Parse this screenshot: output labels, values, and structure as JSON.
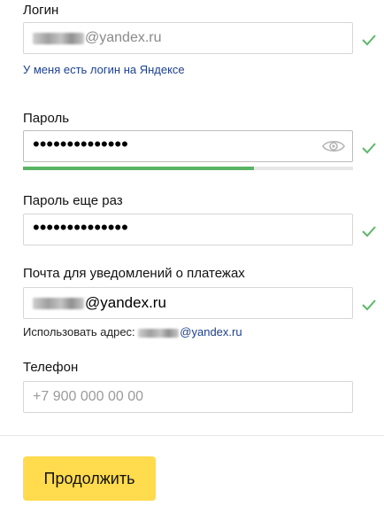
{
  "login": {
    "label": "Логин",
    "value_suffix": "@yandex.ru",
    "link": "У меня есть логин на Яндексе"
  },
  "password": {
    "label": "Пароль",
    "masked": "••••••••••••••",
    "strength": 0.7
  },
  "password_repeat": {
    "label": "Пароль еще раз",
    "masked": "••••••••••••••"
  },
  "notify_email": {
    "label": "Почта для уведомлений о платежах",
    "value_suffix": "@yandex.ru",
    "hint_prefix": "Использовать адрес:",
    "hint_suffix": "@yandex.ru"
  },
  "phone": {
    "label": "Телефон",
    "placeholder": "+7 900 000 00 00"
  },
  "continue_button": "Продолжить",
  "colors": {
    "check": "#5cb868",
    "strength": "#59b463",
    "button": "#ffdb4d",
    "link": "#1c3f8f"
  },
  "icons": [
    "check-icon",
    "eye-icon"
  ]
}
